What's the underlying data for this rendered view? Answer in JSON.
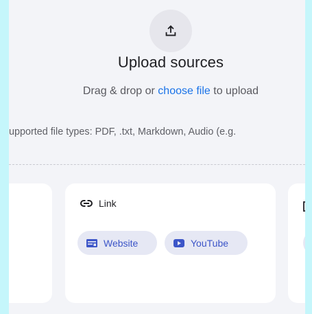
{
  "upload": {
    "icon": "upload-icon",
    "title": "Upload sources",
    "subtitle_prefix": "Drag & drop or ",
    "subtitle_link": "choose file",
    "subtitle_suffix": " to upload",
    "file_types": "upported file types: PDF, .txt, Markdown, Audio (e.g."
  },
  "cards": {
    "link": {
      "icon": "link-icon",
      "label": "Link",
      "chips": [
        {
          "label": "Website",
          "icon": "website-icon"
        },
        {
          "label": "YouTube",
          "icon": "youtube-icon"
        }
      ]
    }
  },
  "colors": {
    "accent": "#1a73e8",
    "chip_text": "#3c55c8",
    "chip_bg": "#e6e8f4",
    "panel_bg": "#f3f4f8"
  }
}
